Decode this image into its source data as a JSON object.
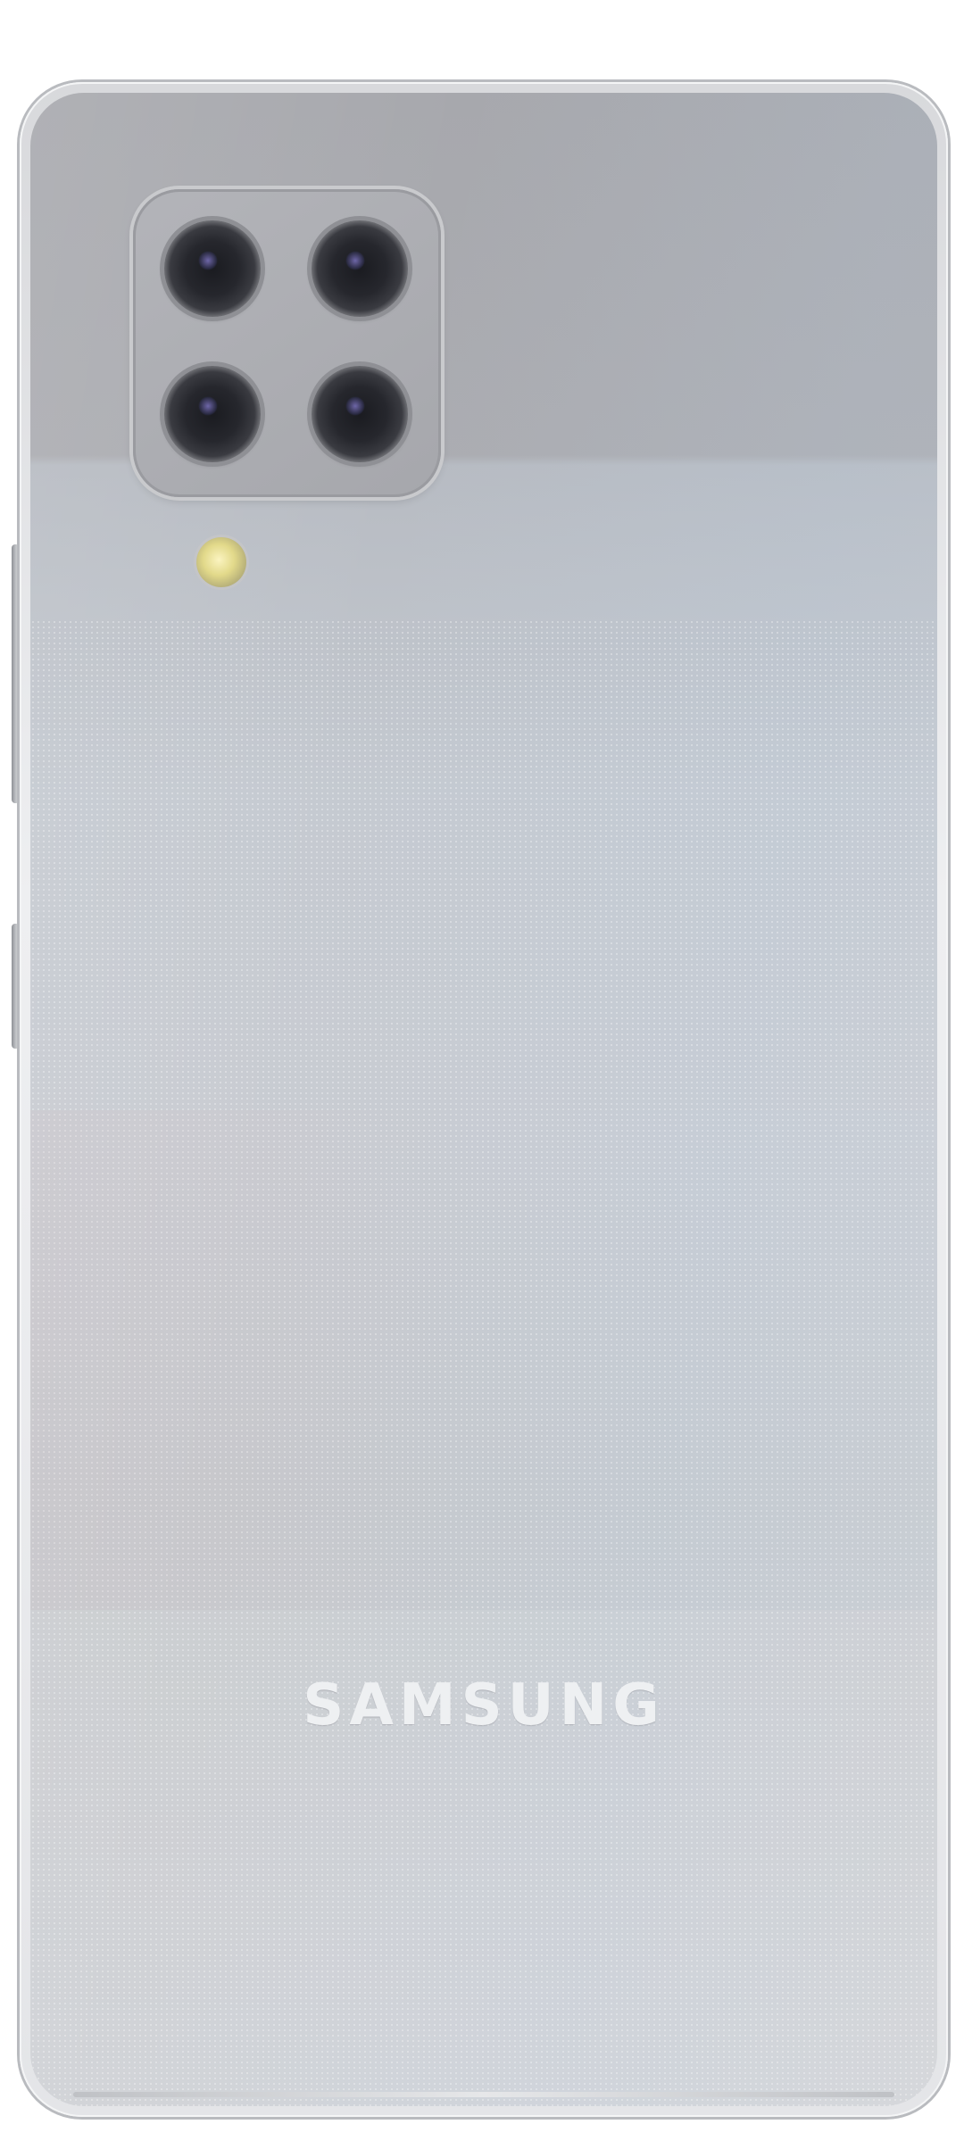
{
  "device": {
    "brand_logo": "SAMSUNG",
    "colors": {
      "body_upper": "#a7a8ad",
      "body_lower": "#c9ccd2",
      "frame": "#b9bbbf",
      "lens": "#1a1b20"
    },
    "icons": {
      "lens_1": "camera-lens-icon",
      "lens_2": "camera-lens-icon",
      "lens_3": "camera-lens-icon",
      "lens_4": "camera-lens-icon",
      "flash": "flash-icon"
    }
  }
}
